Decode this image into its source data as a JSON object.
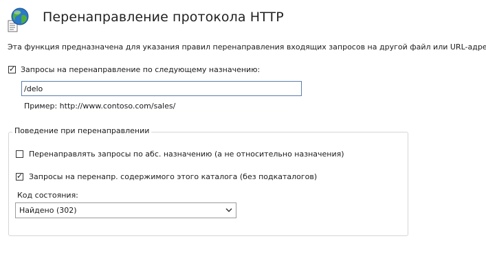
{
  "header": {
    "title": "Перенаправление протокола HTTP",
    "icon": "globe-document-icon"
  },
  "description": "Эта функция предназначена для указания правил перенаправления входящих запросов на другой файл или URL-адрес.",
  "redirect_enabled": {
    "label": "Запросы на перенаправление по следующему назначению:",
    "checked": true
  },
  "destination": {
    "value": "/delo"
  },
  "example": "Пример: http://www.contoso.com/sales/",
  "behavior": {
    "group_title": "Поведение при перенаправлении",
    "absolute_option": {
      "label": "Перенаправлять запросы по абс. назначению (а не относительно назначения)",
      "checked": false
    },
    "directory_option": {
      "label": "Запросы на перенапр. содержимого этого каталога (без подкаталогов)",
      "checked": true
    },
    "status_code": {
      "label": "Код состояния:",
      "selected": "Найдено (302)"
    }
  },
  "colors": {
    "input_border": "#5a7da8",
    "group_border": "#d5d5d5"
  }
}
